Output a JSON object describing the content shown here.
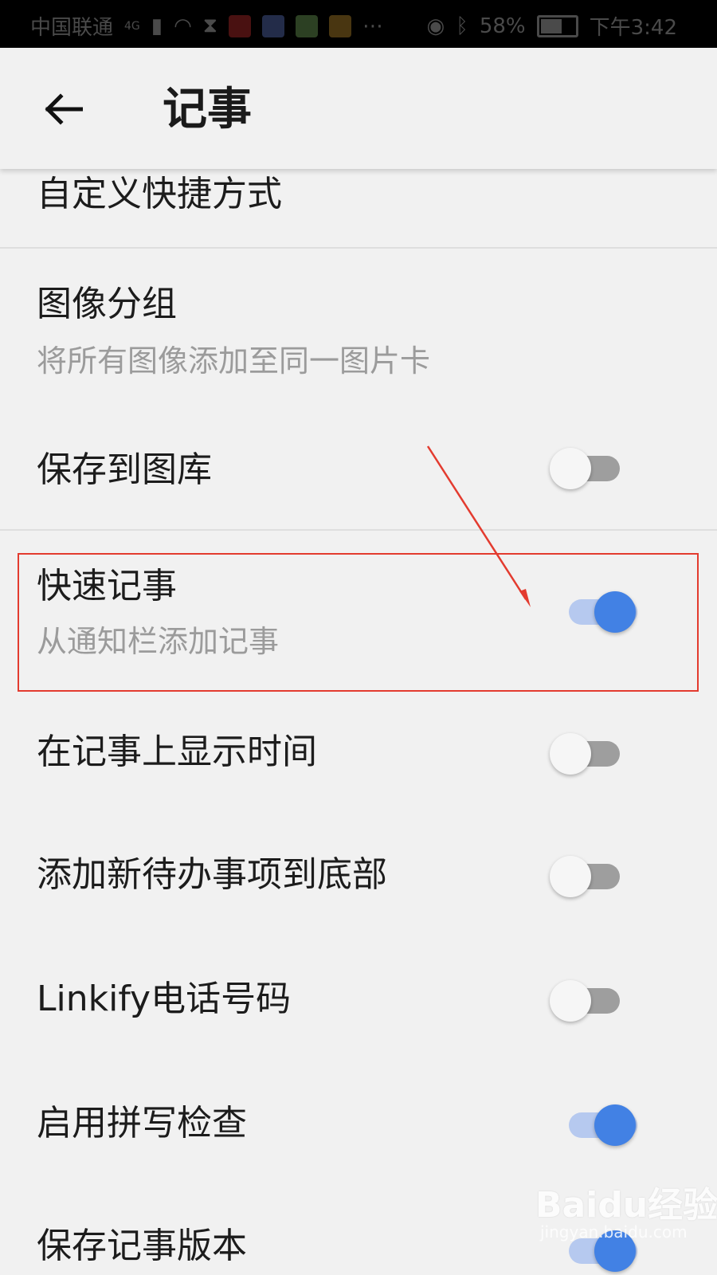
{
  "status_bar": {
    "carrier": "中国联通",
    "network": "4G",
    "battery": "58%",
    "time": "下午3:42"
  },
  "app_bar": {
    "title": "记事",
    "back_icon": "arrow-left-icon"
  },
  "settings": [
    {
      "title": "自定义快捷方式"
    },
    {
      "title": "图像分组",
      "subtitle": "将所有图像添加至同一图片卡"
    },
    {
      "title": "保存到图库",
      "toggle": false
    },
    {
      "title": "快速记事",
      "subtitle": "从通知栏添加记事",
      "toggle": true
    },
    {
      "title": "在记事上显示时间",
      "toggle": false
    },
    {
      "title": "添加新待办事项到底部",
      "toggle": false
    },
    {
      "title": "Linkify电话号码",
      "toggle": false
    },
    {
      "title": "启用拼写检查",
      "toggle": true
    },
    {
      "title": "保存记事版本",
      "toggle": true
    }
  ],
  "watermark": {
    "brand": "Baidu经验",
    "url": "jingyan.baidu.com"
  },
  "colors": {
    "accent": "#4281e4",
    "annotation": "#e33b2f"
  }
}
